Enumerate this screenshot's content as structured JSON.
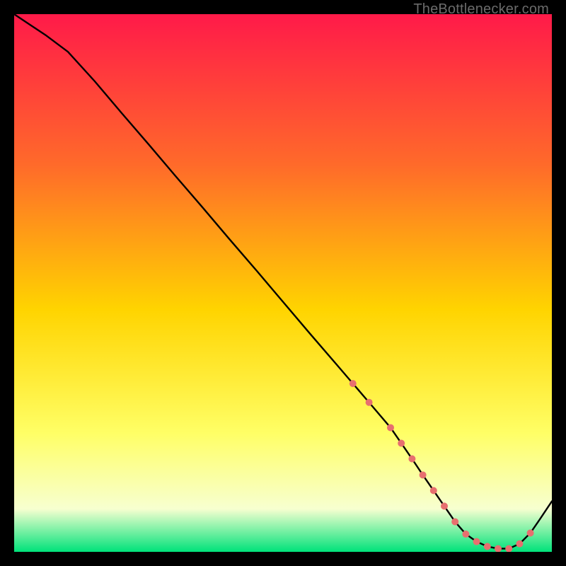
{
  "attribution": "TheBottlenecker.com",
  "colors": {
    "gradient_top": "#ff1a49",
    "gradient_mid1": "#ff6a2a",
    "gradient_mid2": "#ffd400",
    "gradient_mid3": "#ffff66",
    "gradient_low": "#f7ffd0",
    "gradient_bottom": "#00e27a",
    "curve": "#000000",
    "marker": "#e76f6f"
  },
  "chart_data": {
    "type": "line",
    "title": "",
    "xlabel": "",
    "ylabel": "",
    "xlim": [
      0,
      100
    ],
    "ylim": [
      0,
      100
    ],
    "grid": false,
    "legend": null,
    "series": [
      {
        "name": "bottleneck-curve",
        "x": [
          0,
          3,
          6,
          10,
          15,
          20,
          25,
          30,
          35,
          40,
          45,
          50,
          55,
          60,
          63,
          66,
          70,
          72,
          74,
          76,
          78,
          80,
          82,
          84,
          86,
          88,
          90,
          92,
          94,
          96,
          98,
          100
        ],
        "y": [
          100,
          98,
          96,
          93,
          87.5,
          81.6,
          75.8,
          69.9,
          64.1,
          58.2,
          52.4,
          46.5,
          40.6,
          34.8,
          31.3,
          27.8,
          23.1,
          20.2,
          17.3,
          14.3,
          11.4,
          8.5,
          5.6,
          3.3,
          1.9,
          1.0,
          0.6,
          0.6,
          1.5,
          3.5,
          6.4,
          9.4
        ]
      }
    ],
    "markers": {
      "name": "highlighted-points",
      "x": [
        63,
        66,
        70,
        72,
        74,
        76,
        78,
        80,
        82,
        84,
        86,
        88,
        90,
        92,
        94,
        96
      ],
      "y": [
        31.3,
        27.8,
        23.1,
        20.2,
        17.3,
        14.3,
        11.4,
        8.5,
        5.6,
        3.3,
        1.9,
        1.0,
        0.6,
        0.6,
        1.5,
        3.5
      ]
    }
  }
}
